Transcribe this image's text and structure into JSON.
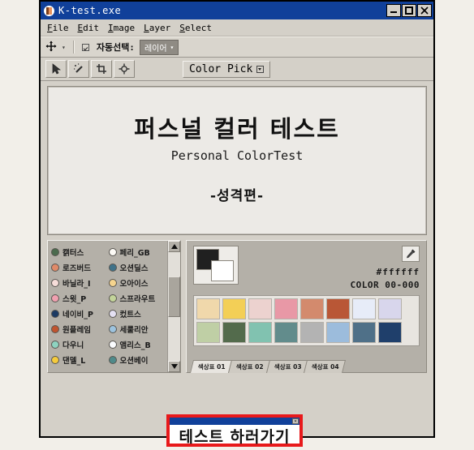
{
  "window": {
    "title": "K-test.exe",
    "icon": "app-icon",
    "controls": {
      "minimize": "_",
      "maximize": "□",
      "close": "✕"
    }
  },
  "menubar": {
    "items": [
      {
        "label": "File",
        "mnemonic": "F",
        "rest": "ile"
      },
      {
        "label": "Edit",
        "mnemonic": "E",
        "rest": "dit"
      },
      {
        "label": "Image",
        "mnemonic": "I",
        "rest": "mage"
      },
      {
        "label": "Layer",
        "mnemonic": "L",
        "rest": "ayer"
      },
      {
        "label": "Select",
        "mnemonic": "S",
        "rest": "elect"
      }
    ]
  },
  "optionbar": {
    "move_tool_icon": "move-tool-icon",
    "autoselect_label": "자동선택:",
    "autoselect_checked": true,
    "layer_dropdown_value": "레이어"
  },
  "toolrow": {
    "tools": [
      {
        "name": "pointer-tool",
        "icon": "pointer-icon"
      },
      {
        "name": "magic-wand-tool",
        "icon": "magic-wand-icon"
      },
      {
        "name": "crop-tool",
        "icon": "crop-icon"
      },
      {
        "name": "move-target-tool",
        "icon": "move-target-icon"
      }
    ],
    "colorpick_label": "Color Pick"
  },
  "canvas": {
    "title": "퍼스널 컬러 테스트",
    "subtitle": "Personal ColorTest",
    "section": "-성격편-"
  },
  "color_list": {
    "items": [
      {
        "label": "캙터스",
        "color": "#4b6b4e"
      },
      {
        "label": "페리_GB",
        "color": "#fdfbf6"
      },
      {
        "label": "로즈버드",
        "color": "#e08a68"
      },
      {
        "label": "오션딜스",
        "color": "#3f7289"
      },
      {
        "label": "바닐라_I",
        "color": "#f6ddd9"
      },
      {
        "label": "오아이스",
        "color": "#f5d48e"
      },
      {
        "label": "스윗_P",
        "color": "#f0a0b0"
      },
      {
        "label": "스프라우트",
        "color": "#c3d49a"
      },
      {
        "label": "네이비_P",
        "color": "#1c3a63"
      },
      {
        "label": "컸트스",
        "color": "#e4e0f2"
      },
      {
        "label": "원플레임",
        "color": "#c0542f"
      },
      {
        "label": "세룰리안",
        "color": "#9dc3de"
      },
      {
        "label": "다우니",
        "color": "#8ed3c0"
      },
      {
        "label": "앰리스_B",
        "color": "#fbfcfe"
      },
      {
        "label": "댄델_L",
        "color": "#f5cb3c"
      },
      {
        "label": "오션베이",
        "color": "#4f8a8a"
      }
    ],
    "scrollbar": {
      "up": "▲",
      "down": "▼"
    }
  },
  "swatch_panel": {
    "foreground_color": "#202020",
    "background_color": "#ffffff",
    "eyedropper_icon": "eyedropper-icon",
    "hex_value": "#ffffff",
    "color_code": "COLOR 00-000",
    "swatches": [
      [
        "#f0d8ab",
        "#f3cf56",
        "#ecd2cf",
        "#e898a6",
        "#d38a6d",
        "#b95736",
        "#e7ecf8",
        "#d8d6ec"
      ],
      [
        "#bfcfa5",
        "#536b4c",
        "#81c2b0",
        "#628c8c",
        "#b3b3b3",
        "#9cbcdc",
        "#4f7088",
        "#1f3f6b"
      ]
    ],
    "tabs": [
      {
        "label": "색상표 01",
        "active": true
      },
      {
        "label": "색상표 02",
        "active": false
      },
      {
        "label": "색상표 03",
        "active": false
      },
      {
        "label": "색상표 04",
        "active": false
      }
    ]
  },
  "cta": {
    "label": "테스트 하러가기",
    "close_glyph": "✕",
    "border_color": "#e8191b"
  }
}
